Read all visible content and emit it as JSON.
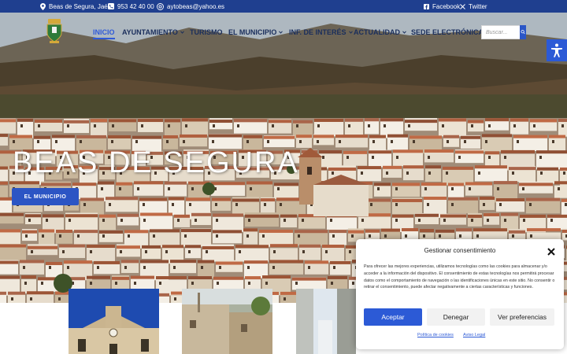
{
  "topbar": {
    "location": "Beas de Segura, Jaén",
    "phone": "953 42 40 00",
    "email": "aytobeas@yahoo.es",
    "facebook": "Facebook",
    "twitter": "Twitter"
  },
  "menu": {
    "items": [
      {
        "label": "INICIO",
        "active": true,
        "dropdown": false
      },
      {
        "label": "AYUNTAMIENTO",
        "active": false,
        "dropdown": true
      },
      {
        "label": "TURISMO",
        "active": false,
        "dropdown": false
      },
      {
        "label": "EL MUNICIPIO",
        "active": false,
        "dropdown": true
      },
      {
        "label": "INF. DE INTERÉS",
        "active": false,
        "dropdown": true
      },
      {
        "label": "ACTUALIDAD",
        "active": false,
        "dropdown": true
      },
      {
        "label": "SEDE ELECTRÓNICA",
        "active": false,
        "dropdown": false
      }
    ]
  },
  "search": {
    "placeholder": "Buscar..."
  },
  "hero": {
    "title": "BEAS DE SEGURA",
    "button_label": "EL MUNICIPIO"
  },
  "cookie": {
    "title": "Gestionar consentimiento",
    "text": "Para ofrecer las mejores experiencias, utilizamos tecnologías como las cookies para almacenar y/o acceder a la información del dispositivo. El consentimiento de estas tecnologías nos permitirá procesar datos como el comportamiento de navegación o las identificaciones únicas en este sitio. No consentir o retirar el consentimiento, puede afectar negativamente a ciertas características y funciones.",
    "accept_label": "Aceptar",
    "deny_label": "Denegar",
    "prefs_label": "Ver preferencias",
    "cookie_policy": "Política de cookies",
    "legal_notice": "Aviso Legal"
  },
  "colors": {
    "topbar": "#1f3f8f",
    "accent": "#2c5ad6",
    "menu_text": "#1a2e5c"
  }
}
